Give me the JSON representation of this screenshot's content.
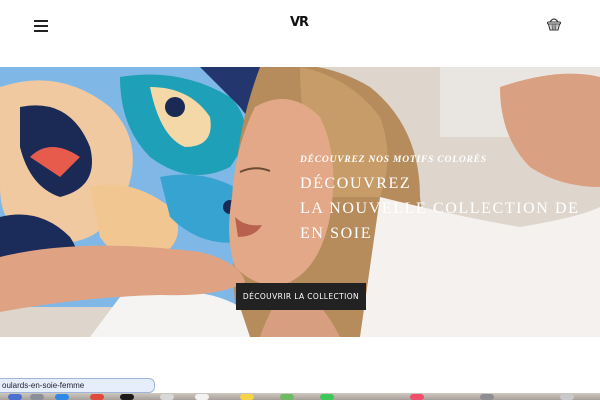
{
  "header": {
    "menu_icon": "hamburger-menu-icon",
    "logo_text": "VR",
    "basket_icon": "shopping-basket-icon"
  },
  "hero": {
    "subtitle": "Découvrez nos motifs colorés",
    "title_lines": [
      "Découvrez",
      "la nouvelle collection de",
      "en soie"
    ],
    "cta_label": "Découvrir la collection"
  },
  "status_bar": {
    "url_fragment": "oulards-en-soie-femme"
  },
  "colors": {
    "cta_background": "#222222",
    "header_background": "#ffffff",
    "text_on_image": "#ffffff"
  },
  "dock": {
    "icons": [
      "finder-icon",
      "launchpad-icon",
      "safari-icon",
      "chrome-icon",
      "mail-icon",
      "photos-icon",
      "calendar-icon",
      "notes-icon",
      "maps-icon",
      "messages-icon",
      "music-icon",
      "settings-icon",
      "trash-icon"
    ]
  }
}
